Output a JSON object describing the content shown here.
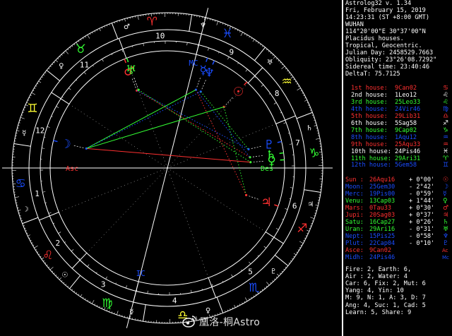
{
  "header": {
    "app": "Astrolog32 v. 1.34",
    "date": "Fri, February 15, 2019",
    "time": "14:23:31 (ST +8:00 GMT)",
    "location": "WUHAN",
    "coords": "114°20'00\"E 30°37'00\"N",
    "system": "Placidus houses.",
    "zodiac": "Tropical, Geocentric.",
    "julian": "Julian Day: 2458529.7663",
    "obliquity": "Obliquity: 23°26'08.7292\"",
    "sidereal": "Sidereal time: 23:40:46",
    "delta": "DeltaT: 75.7125"
  },
  "houses": [
    {
      "label": "1st house:",
      "value": "9Can02",
      "color": "#ff3030",
      "glyph": "♋"
    },
    {
      "label": "2nd house:",
      "value": "1Leo12",
      "color": "#ffffff",
      "glyph": "♌"
    },
    {
      "label": "3rd house:",
      "value": "25Leo33",
      "color": "#33ff33",
      "glyph": "♌"
    },
    {
      "label": "4th house:",
      "value": "24Vir46",
      "color": "#1a4dff",
      "glyph": "♍"
    },
    {
      "label": "5th house:",
      "value": "29Lib31",
      "color": "#ff3030",
      "glyph": "♎"
    },
    {
      "label": "6th house:",
      "value": "5Sag58",
      "color": "#ffffff",
      "glyph": "♐"
    },
    {
      "label": "7th house:",
      "value": "9Cap02",
      "color": "#33ff33",
      "glyph": "♑"
    },
    {
      "label": "8th house:",
      "value": "1Aqu12",
      "color": "#1a4dff",
      "glyph": "♒"
    },
    {
      "label": "9th house:",
      "value": "25Aqu33",
      "color": "#ff3030",
      "glyph": "♒"
    },
    {
      "label": "10th house:",
      "value": "24Pis46",
      "color": "#ffffff",
      "glyph": "♓"
    },
    {
      "label": "11th house:",
      "value": "29Ari31",
      "color": "#33ff33",
      "glyph": "♈"
    },
    {
      "label": "12th house:",
      "value": "5Gem58",
      "color": "#1a4dff",
      "glyph": "♊"
    }
  ],
  "planets": [
    {
      "label": "Sun :",
      "value": "26Aqu16",
      "speed": "+ 0°00'",
      "color": "#ff3030",
      "glyph": "☉"
    },
    {
      "label": "Moon:",
      "value": "25Gem30",
      "speed": "- 2°42'",
      "color": "#1a4dff",
      "glyph": "☽"
    },
    {
      "label": "Merc:",
      "value": "19Pis00",
      "speed": "- 0°59'",
      "color": "#1a4dff",
      "glyph": "☿"
    },
    {
      "label": "Venu:",
      "value": "13Cap03",
      "speed": "+ 1°44'",
      "color": "#33ff33",
      "glyph": "♀"
    },
    {
      "label": "Mars:",
      "value": "0Tau33",
      "speed": "+ 0°30'",
      "color": "#ff3030",
      "glyph": "♂"
    },
    {
      "label": "Jupi:",
      "value": "20Sag03",
      "speed": "+ 0°37'",
      "color": "#ff3030",
      "glyph": "♃"
    },
    {
      "label": "Satu:",
      "value": "16Cap27",
      "speed": "+ 0°26'",
      "color": "#33ff33",
      "glyph": "♄"
    },
    {
      "label": "Uran:",
      "value": "29Ari16",
      "speed": "- 0°31'",
      "color": "#33ff33",
      "glyph": "♅"
    },
    {
      "label": "Nept:",
      "value": "15Pis25",
      "speed": "- 0°58'",
      "color": "#1a4dff",
      "glyph": "♆"
    },
    {
      "label": "Plut:",
      "value": "22Cap04",
      "speed": "- 0°10'",
      "color": "#1a4dff",
      "glyph": "♇"
    },
    {
      "label": "Asce:",
      "value": "9Can02",
      "speed": "",
      "color": "#ff3030",
      "glyph": "Ac"
    },
    {
      "label": "Midh:",
      "value": "24Pis46",
      "speed": "",
      "color": "#1a4dff",
      "glyph": "Mc"
    }
  ],
  "stats": [
    "Fire: 2, Earth: 6,",
    "Air : 2, Water: 4",
    "Car: 6, Fix: 2, Mut: 6",
    "Yang: 4, Yin: 10",
    "M: 9, N: 1, A: 3, D: 7",
    "Ang: 4, Suc: 1, Cad: 5",
    "Learn: 5, Share: 9"
  ],
  "wheel": {
    "house_numbers": [
      "1",
      "2",
      "3",
      "4",
      "5",
      "6",
      "7",
      "8",
      "9",
      "10",
      "11",
      "12"
    ],
    "asc_label": "Asc",
    "des_label": "Des",
    "mc_label": "MC",
    "ic_label": "IC",
    "colors": {
      "red": "#ff3030",
      "green": "#33ff33",
      "blue": "#1a4dff",
      "yellow": "#ffff33",
      "white": "#ffffff"
    },
    "signs": [
      {
        "glyph": "♈",
        "color": "#ff3030"
      },
      {
        "glyph": "♉",
        "color": "#33ff33"
      },
      {
        "glyph": "♊",
        "color": "#ffff33"
      },
      {
        "glyph": "♋",
        "color": "#1a4dff"
      },
      {
        "glyph": "♌",
        "color": "#ff3030"
      },
      {
        "glyph": "♍",
        "color": "#33ff33"
      },
      {
        "glyph": "♎",
        "color": "#ffff33"
      },
      {
        "glyph": "♏",
        "color": "#1a4dff"
      },
      {
        "glyph": "♐",
        "color": "#ff3030"
      },
      {
        "glyph": "♑",
        "color": "#33ff33"
      },
      {
        "glyph": "♒",
        "color": "#ffff33"
      },
      {
        "glyph": "♓",
        "color": "#1a4dff"
      }
    ],
    "ruler_glyphs": [
      "♂",
      "♀",
      "☿",
      "☽",
      "☉",
      "☿",
      "♀",
      "♇",
      "♃",
      "♄",
      "♅",
      "♆"
    ],
    "planets": [
      {
        "name": "Sun",
        "glyph": "☉",
        "lon": 326.27,
        "color": "#ff3030"
      },
      {
        "name": "Moon",
        "glyph": "☽",
        "lon": 85.5,
        "color": "#1a4dff"
      },
      {
        "name": "Mercury",
        "glyph": "☿",
        "lon": 349.0,
        "color": "#1a4dff"
      },
      {
        "name": "Venus",
        "glyph": "♀",
        "lon": 283.05,
        "color": "#33ff33"
      },
      {
        "name": "Mars",
        "glyph": "♂",
        "lon": 30.55,
        "color": "#ff3030"
      },
      {
        "name": "Jupiter",
        "glyph": "♃",
        "lon": 260.05,
        "color": "#ff3030"
      },
      {
        "name": "Saturn",
        "glyph": "♄",
        "lon": 286.45,
        "color": "#33ff33"
      },
      {
        "name": "Uranus",
        "glyph": "♅",
        "lon": 29.27,
        "color": "#33ff33"
      },
      {
        "name": "Neptune",
        "glyph": "♆",
        "lon": 345.42,
        "color": "#1a4dff"
      },
      {
        "name": "Pluto",
        "glyph": "♇",
        "lon": 292.07,
        "color": "#1a4dff"
      }
    ],
    "aspects": [
      {
        "a": "Moon",
        "b": "Venus",
        "color": "#ff3030",
        "style": "solid"
      },
      {
        "a": "Moon",
        "b": "Sun",
        "color": "#33ff33",
        "style": "solid"
      },
      {
        "a": "Moon",
        "b": "Mercury",
        "color": "#33ff33",
        "style": "solid"
      },
      {
        "a": "Mars",
        "b": "Saturn",
        "color": "#ff3030",
        "style": "dot"
      },
      {
        "a": "Mars",
        "b": "Pluto",
        "color": "#1a4dff",
        "style": "dot"
      },
      {
        "a": "Uranus",
        "b": "Venus",
        "color": "#33ff33",
        "style": "dot"
      },
      {
        "a": "Sun",
        "b": "Jupiter",
        "color": "#33ff33",
        "style": "dot"
      },
      {
        "a": "Mercury",
        "b": "Jupiter",
        "color": "#ff3030",
        "style": "dot"
      },
      {
        "a": "Neptune",
        "b": "Pluto",
        "color": "#33ff33",
        "style": "dot"
      },
      {
        "a": "Mercury",
        "b": "Saturn",
        "color": "#1a4dff",
        "style": "dot"
      },
      {
        "a": "Moon",
        "b": "Neptune",
        "color": "#1a4dff",
        "style": "dot"
      }
    ],
    "cusps": [
      99.03,
      121.2,
      145.55,
      174.77,
      209.52,
      245.97,
      279.03,
      301.2,
      325.55,
      354.77,
      29.52,
      65.97
    ]
  },
  "watermark": "凰洛-桐Astro"
}
